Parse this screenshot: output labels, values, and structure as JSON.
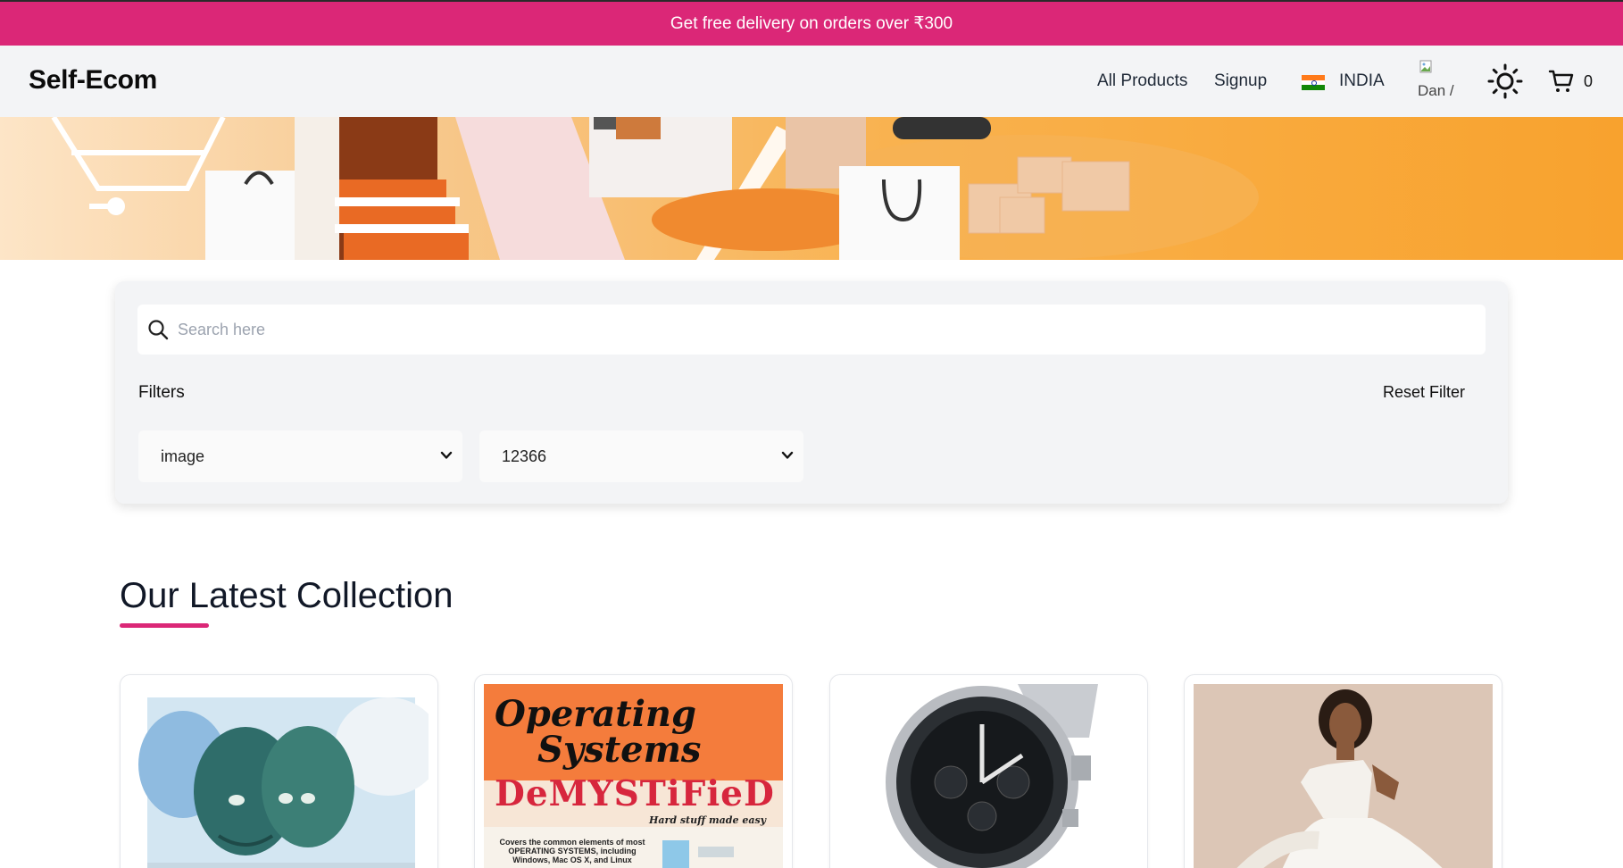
{
  "announcement": {
    "text": "Get free delivery on orders over ₹300"
  },
  "navbar": {
    "brand": "Self-Ecom",
    "links": [
      {
        "label": "All Products"
      },
      {
        "label": "Signup"
      }
    ],
    "country": {
      "label": "INDIA",
      "flag": "india-flag-icon"
    },
    "avatar": {
      "alt_text": "Dan /"
    },
    "theme_icon": "sun-icon",
    "cart": {
      "icon": "cart-icon",
      "count": "0"
    }
  },
  "search": {
    "placeholder": "Search here",
    "value": "",
    "icon": "search-icon"
  },
  "filters": {
    "label": "Filters",
    "reset_label": "Reset Filter",
    "selects": [
      {
        "selected": "image"
      },
      {
        "selected": "12366"
      }
    ]
  },
  "collection": {
    "title": "Our Latest Collection",
    "accent_color": "#db2777",
    "products": [
      {
        "image": "painting-of-two-green-faces"
      },
      {
        "image": "book-cover-operating-systems-demystified",
        "cover_text": {
          "line1": "Operating",
          "line2": "Systems",
          "line3": "DeMYSTiFieD",
          "tagline": "Hard stuff made easy",
          "blurb": "Covers the common elements of most OPERATING SYSTEMS, including Windows, Mac OS X, and Linux"
        }
      },
      {
        "image": "silver-chronograph-wristwatch"
      },
      {
        "image": "woman-in-white-one-shoulder-dress"
      }
    ]
  },
  "colors": {
    "brand_pink": "#db2777",
    "navbar_bg": "#f3f4f6",
    "banner_orange": "#f9a93b"
  }
}
